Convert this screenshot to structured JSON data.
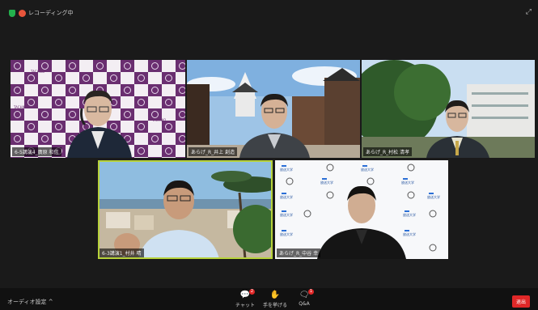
{
  "topbar": {
    "recording_label": "レコーディング中"
  },
  "participants": [
    {
      "name": "6-5講演4_廣原 和信"
    },
    {
      "name": "あらげ_R_井上 創造"
    },
    {
      "name": "あらげ_R_村松 清孝"
    },
    {
      "name": "6-3講演1_村井 晴"
    },
    {
      "name": "あらげ_R_中谷 幸"
    }
  ],
  "backdrop": {
    "logo_text": "TACHIKO",
    "sponsor_text": "放送大学"
  },
  "bottombar": {
    "audio_label": "オーディオ設定 ^",
    "chat_label": "チャット",
    "chat_badge": "2",
    "raise_hand_label": "手を挙げる",
    "qa_label": "Q&A",
    "qa_badge": "1",
    "leave_label": "退出"
  },
  "colors": {
    "active_speaker": "#b7d23a",
    "recording": "#e8553b",
    "leave": "#e02828"
  }
}
